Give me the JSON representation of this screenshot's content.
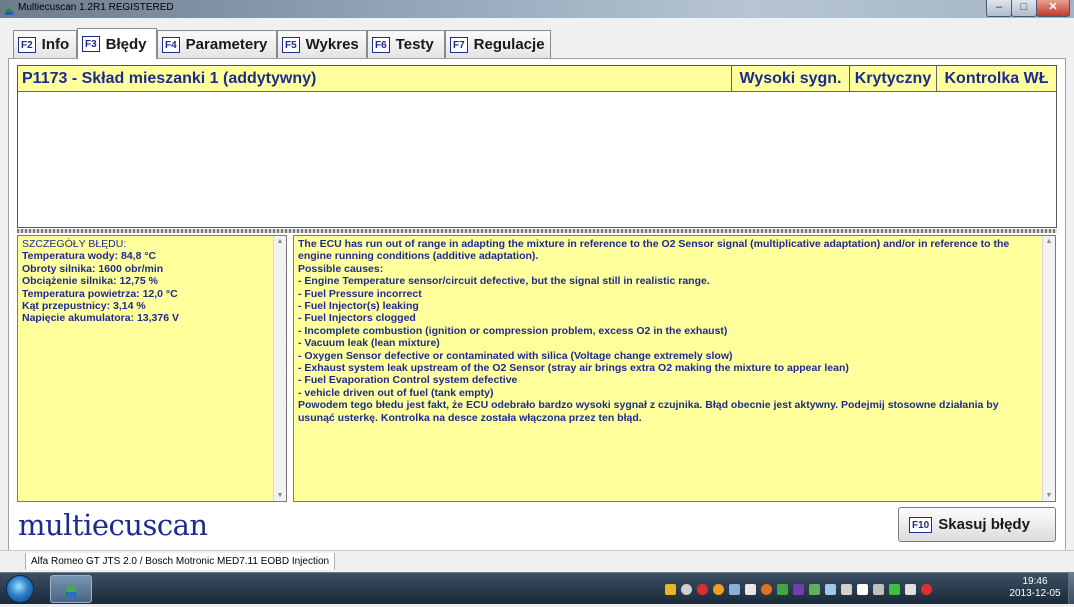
{
  "window": {
    "title": "Multiecuscan 1.2R1 REGISTERED"
  },
  "tabs": [
    {
      "key": "F2",
      "label": "Info"
    },
    {
      "key": "F3",
      "label": "Błędy"
    },
    {
      "key": "F4",
      "label": "Parametery"
    },
    {
      "key": "F5",
      "label": "Wykres"
    },
    {
      "key": "F6",
      "label": "Testy"
    },
    {
      "key": "F7",
      "label": "Regulacje"
    }
  ],
  "fault": {
    "code": "P1173 - Skład mieszanki 1 (addytywny)",
    "high_signal": "Wysoki sygn.",
    "critical": "Krytyczny",
    "mil": "Kontrolka WŁ"
  },
  "details": {
    "heading": "SZCZEGÓŁY BŁĘDU:",
    "lines": [
      "Temperatura wody: 84,8 °C",
      "Obroty silnika: 1600 obr/min",
      "Obciążenie silnika: 12,75 %",
      "Temperatura powietrza: 12,0 °C",
      "Kąt przepustnicy: 3,14 %",
      "Napięcie akumulatora: 13,376 V"
    ]
  },
  "description": [
    "The ECU has run out of range in adapting the mixture in reference to the O2 Sensor signal (multiplicative adaptation) and/or in reference to the engine running conditions (additive adaptation).",
    "Possible causes:",
    "- Engine Temperature sensor/circuit defective, but the signal still in realistic range.",
    "- Fuel Pressure incorrect",
    "- Fuel Injector(s) leaking",
    "- Fuel Injectors clogged",
    "- Incomplete combustion (ignition or compression problem, excess O2 in the exhaust)",
    "- Vacuum leak (lean mixture)",
    "- Oxygen Sensor defective or contaminated with silica (Voltage change extremely slow)",
    "- Exhaust system leak upstream of the O2 Sensor (stray air brings extra O2 making the mixture to appear lean)",
    "- Fuel Evaporation Control system defective",
    "- vehicle driven out of fuel (tank empty)",
    "Powodem tego błedu jest fakt, że ECU odebrało bardzo wysoki sygnał z czujnika. Błąd obecnie jest aktywny. Podejmij stosowne działania by usunąć usterkę. Kontrolka na desce została włączona przez ten błąd."
  ],
  "logo": "multiecuscan",
  "clear_button": {
    "key": "F10",
    "label": "Skasuj błędy"
  },
  "status": {
    "vehicle": "Alfa Romeo GT JTS 2.0 / Bosch Motronic MED7.11 EOBD Injection"
  },
  "clock": {
    "time": "19:46",
    "date": "2013-12-05"
  },
  "colors": {
    "panel_bg": "#ffff9c",
    "text_blue": "#1d2b8f"
  }
}
